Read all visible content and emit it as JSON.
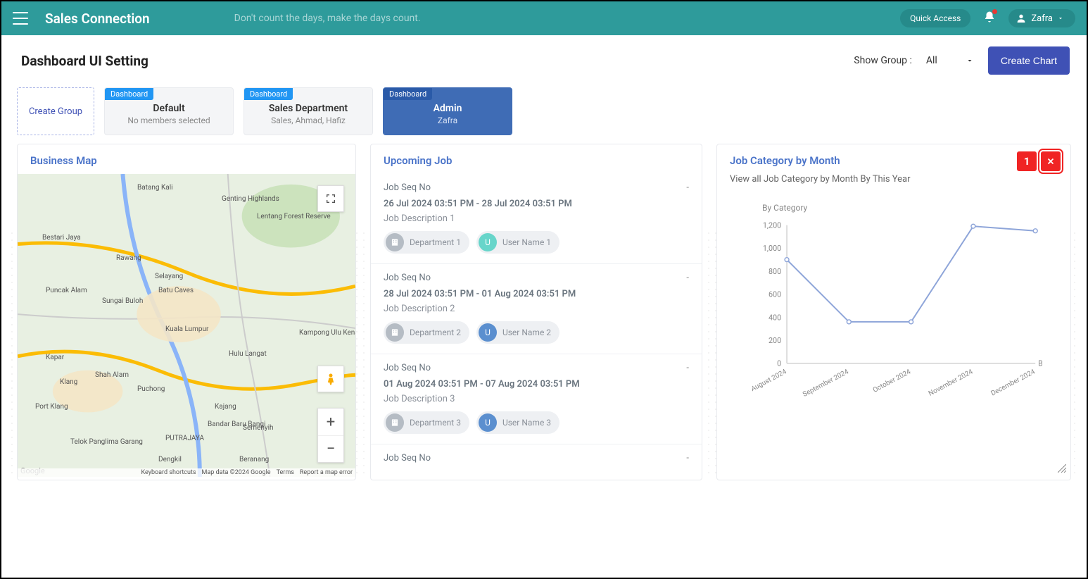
{
  "header": {
    "brand": "Sales Connection",
    "tagline": "Don't count the days, make the days count.",
    "quick_access": "Quick Access",
    "user_name": "Zafra"
  },
  "page": {
    "title": "Dashboard UI Setting",
    "show_group_label": "Show Group :",
    "show_group_value": "All",
    "create_chart": "Create Chart"
  },
  "groups": {
    "create_label": "Create Group",
    "badge": "Dashboard",
    "items": [
      {
        "name": "Default",
        "sub": "No members selected",
        "active": false
      },
      {
        "name": "Sales Department",
        "sub": "Sales, Ahmad, Hafiz",
        "active": false
      },
      {
        "name": "Admin",
        "sub": "Zafra",
        "active": true
      }
    ]
  },
  "map_panel": {
    "title": "Business Map",
    "attrib": {
      "shortcuts": "Keyboard shortcuts",
      "mapdata": "Map data ©2024 Google",
      "terms": "Terms",
      "report": "Report a map error"
    },
    "google": "Google",
    "places": [
      "Batang Kali",
      "Genting Highlands",
      "Lentang Forest Reserve",
      "Rawang",
      "Selayang",
      "Batu Caves",
      "Puncak Alam",
      "Sungai Buloh",
      "Kuala Lumpur",
      "Kampong Ulu Kenaboi",
      "Hulu Langat",
      "Klang",
      "Shah Alam",
      "Puchong",
      "Port Klang",
      "Kajang",
      "Bandar Baru Bangi",
      "Semenyih",
      "PUTRAJAYA",
      "Telok Panglima Garang",
      "Dengkil",
      "Beranang",
      "Kapar",
      "Bestari Jaya"
    ]
  },
  "jobs_panel": {
    "title": "Upcoming Job",
    "items": [
      {
        "seq": "Job Seq No",
        "date": "26 Jul 2024 03:51 PM - 28 Jul 2024 03:51 PM",
        "desc": "Job Description 1",
        "dept": "Department 1",
        "user": "User Name 1",
        "user_color": "teal"
      },
      {
        "seq": "Job Seq No",
        "date": "28 Jul 2024 03:51 PM - 01 Aug 2024 03:51 PM",
        "desc": "Job Description 2",
        "dept": "Department 2",
        "user": "User Name 2",
        "user_color": "blue"
      },
      {
        "seq": "Job Seq No",
        "date": "01 Aug 2024 03:51 PM - 07 Aug 2024 03:51 PM",
        "desc": "Job Description 3",
        "dept": "Department 3",
        "user": "User Name 3",
        "user_color": "blue-d"
      },
      {
        "seq": "Job Seq No"
      }
    ]
  },
  "chart_panel": {
    "title": "Job Category by Month",
    "subtitle": "View all Job Category by Month By This Year",
    "badge_num": "1",
    "y_title": "By Category",
    "x_title": "By Mo"
  },
  "chart_data": {
    "type": "line",
    "categories": [
      "August 2024",
      "September 2024",
      "October 2024",
      "November 2024",
      "December 2024"
    ],
    "values": [
      900,
      360,
      360,
      1190,
      1150
    ],
    "title": "By Category",
    "xlabel": "By Mo",
    "ylabel": "By Category",
    "ylim": [
      0,
      1200
    ],
    "y_ticks": [
      0,
      200,
      400,
      600,
      800,
      1000,
      1200
    ]
  }
}
